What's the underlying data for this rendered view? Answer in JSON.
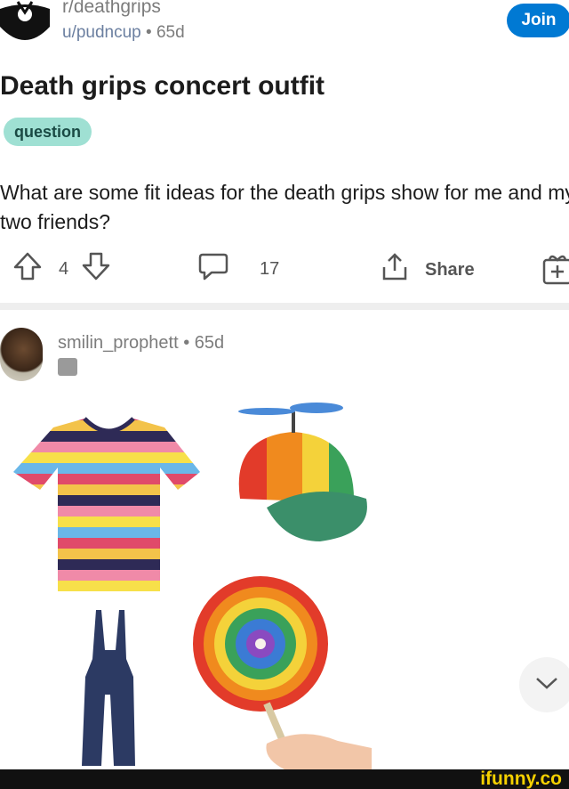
{
  "post": {
    "subreddit": "r/deathgrips",
    "author": "u/pudncup",
    "separator": "•",
    "age": "65d",
    "join_label": "Join",
    "title": "Death grips concert outfit",
    "flair": "question",
    "body": "What are some fit ideas for the death grips show for me and my two friends?"
  },
  "actions": {
    "votes": "4",
    "comments": "17",
    "share_label": "Share"
  },
  "comment": {
    "username": "smilin_prophett",
    "separator": "•",
    "age": "65d"
  },
  "image_items": [
    "striped-tshirt",
    "propeller-cap",
    "denim-overalls",
    "rainbow-lollipop"
  ],
  "watermark": "ifunny.co",
  "colors": {
    "join": "#0079d3",
    "flair_bg": "#9fe0d3",
    "meta_text": "#7c7c7c",
    "watermark": "#f5d000"
  }
}
